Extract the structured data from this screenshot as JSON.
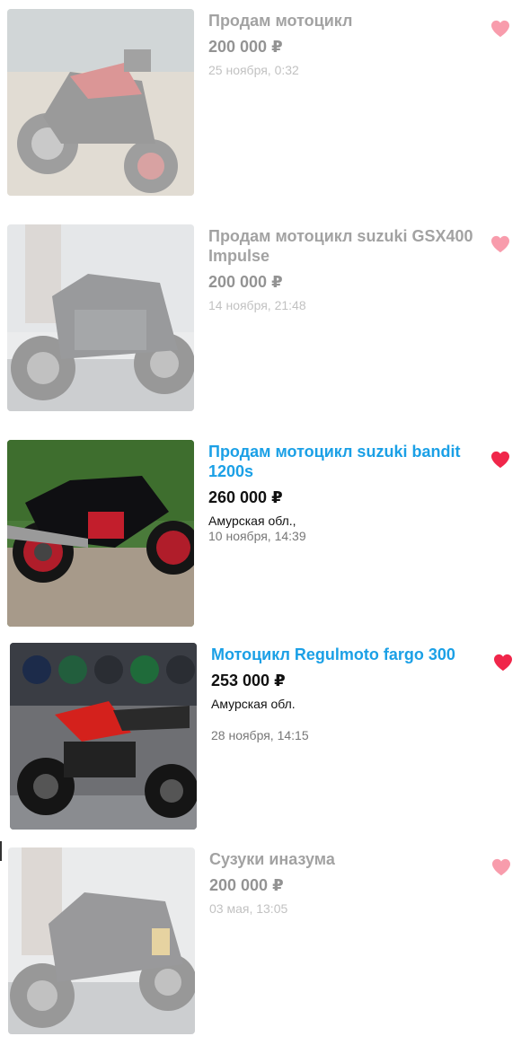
{
  "accent_color": "#1ba0e6",
  "favorite_color": "#f0264a",
  "listings": [
    {
      "title": "Продам мотоцикл",
      "price": "200 000 ₽",
      "region": "",
      "date": "25 ноября, 0:32",
      "status": "inactive",
      "favorited": true,
      "icon": "heart-icon"
    },
    {
      "title": "Продам мотоцикл suzuki GSX400 Impulse",
      "price": "200 000 ₽",
      "region": "",
      "date": "14 ноября, 21:48",
      "status": "inactive",
      "favorited": true,
      "icon": "heart-icon"
    },
    {
      "title": "Продам мотоцикл suzuki bandit 1200s",
      "price": "260 000 ₽",
      "region": "Амурская обл.,",
      "date": "10 ноября, 14:39",
      "status": "active",
      "favorited": true,
      "icon": "heart-icon"
    },
    {
      "title": "Мотоцикл Regulmoto fargo 300",
      "price": "253 000 ₽",
      "region": "Амурская обл.",
      "date": "28 ноября, 14:15",
      "status": "active",
      "favorited": true,
      "icon": "heart-icon"
    },
    {
      "title": "Сузуки иназума",
      "price": "200 000 ₽",
      "region": "",
      "date": "03 мая, 13:05",
      "status": "inactive",
      "favorited": true,
      "icon": "heart-icon"
    }
  ]
}
